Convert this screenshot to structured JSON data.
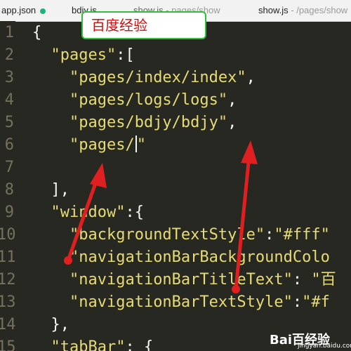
{
  "tabs": [
    {
      "label": "app.json",
      "path": ""
    },
    {
      "label": "bdjy.js",
      "path": ""
    },
    {
      "label": "show.js",
      "path": "- pages/show"
    },
    {
      "label": "show.js",
      "path": "- /pages/show"
    }
  ],
  "overlay_label": "百度经验",
  "line_numbers": [
    "1",
    "2",
    "3",
    "4",
    "5",
    "6",
    "7",
    "8",
    "9",
    "10",
    "11",
    "12",
    "13",
    "14",
    "15"
  ],
  "code_lines": [
    {
      "indent": "",
      "parts": [
        {
          "t": "{",
          "c": "punc"
        }
      ]
    },
    {
      "indent": "  ",
      "parts": [
        {
          "t": "\"pages\"",
          "c": "str"
        },
        {
          "t": ":[",
          "c": "punc"
        }
      ]
    },
    {
      "indent": "    ",
      "parts": [
        {
          "t": "\"pages/index/index\"",
          "c": "str"
        },
        {
          "t": ",",
          "c": "punc"
        }
      ]
    },
    {
      "indent": "    ",
      "parts": [
        {
          "t": "\"pages/logs/logs\"",
          "c": "str"
        },
        {
          "t": ",",
          "c": "punc"
        }
      ]
    },
    {
      "indent": "    ",
      "parts": [
        {
          "t": "\"pages/bdjy/bdjy\"",
          "c": "str"
        },
        {
          "t": ",",
          "c": "punc"
        }
      ]
    },
    {
      "indent": "    ",
      "parts": [
        {
          "t": "\"pages/",
          "c": "str"
        },
        {
          "t": "CURSOR",
          "c": "cursor"
        },
        {
          "t": "\"",
          "c": "str"
        }
      ]
    },
    {
      "indent": "",
      "parts": []
    },
    {
      "indent": "  ",
      "parts": [
        {
          "t": "],",
          "c": "punc"
        }
      ]
    },
    {
      "indent": "  ",
      "parts": [
        {
          "t": "\"window\"",
          "c": "str"
        },
        {
          "t": ":{",
          "c": "punc"
        }
      ]
    },
    {
      "indent": "    ",
      "parts": [
        {
          "t": "\"backgroundTextStyle\"",
          "c": "str"
        },
        {
          "t": ":",
          "c": "punc"
        },
        {
          "t": "\"#fff\"",
          "c": "str"
        }
      ]
    },
    {
      "indent": "    ",
      "parts": [
        {
          "t": "\"navigationBarBackgroundColo",
          "c": "str"
        }
      ]
    },
    {
      "indent": "    ",
      "parts": [
        {
          "t": "\"navigationBarTitleText\"",
          "c": "str"
        },
        {
          "t": ": ",
          "c": "punc"
        },
        {
          "t": "\"百",
          "c": "str"
        }
      ]
    },
    {
      "indent": "    ",
      "parts": [
        {
          "t": "\"navigationBarTextStyle\"",
          "c": "str"
        },
        {
          "t": ":",
          "c": "punc"
        },
        {
          "t": "\"#f",
          "c": "str"
        }
      ]
    },
    {
      "indent": "  ",
      "parts": [
        {
          "t": "},",
          "c": "punc"
        }
      ]
    },
    {
      "indent": "  ",
      "parts": [
        {
          "t": "\"tabBar\"",
          "c": "str"
        },
        {
          "t": ": {",
          "c": "punc"
        }
      ]
    }
  ],
  "watermark": {
    "brand": "Bai百经验",
    "site": "jingyan.baidu.com"
  },
  "colors": {
    "background": "#272822",
    "string": "#e6db74",
    "arrow": "#e02020",
    "badge_border": "#2fbf3a"
  }
}
